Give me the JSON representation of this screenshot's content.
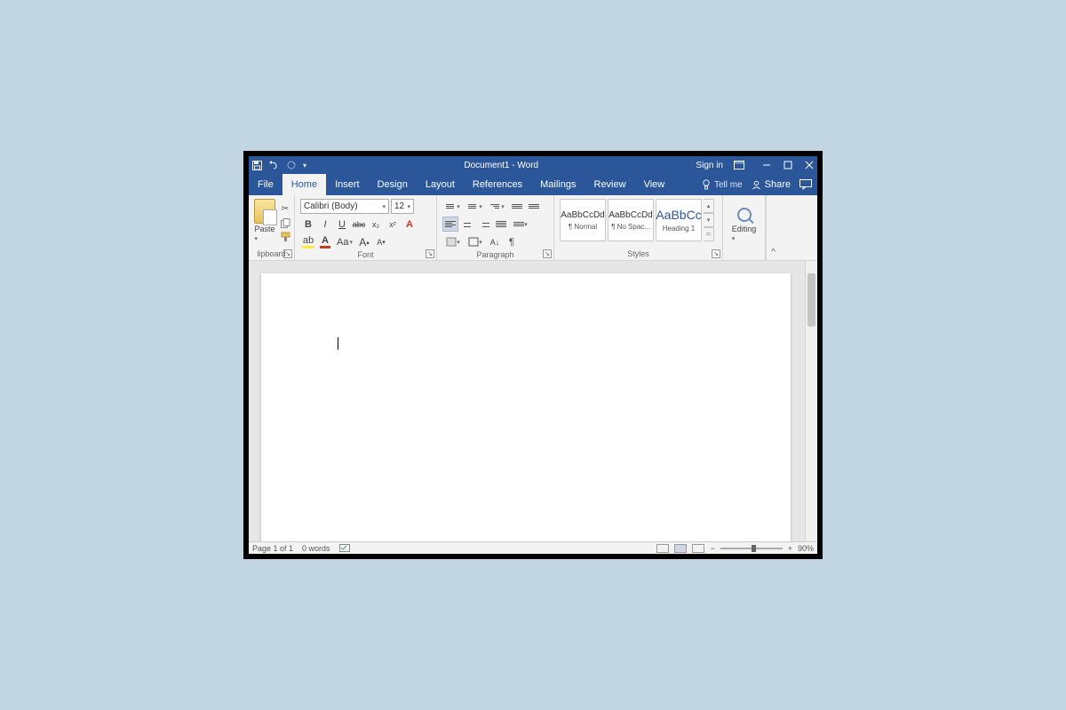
{
  "title": "Document1  -  Word",
  "sign_in": "Sign in",
  "tabs": {
    "file": "File",
    "home": "Home",
    "insert": "Insert",
    "design": "Design",
    "layout": "Layout",
    "references": "References",
    "mailings": "Mailings",
    "review": "Review",
    "view": "View"
  },
  "tellme": "Tell me",
  "share": "Share",
  "clipboard": {
    "paste": "Paste",
    "label": "lipboard"
  },
  "font": {
    "name": "Calibri (Body)",
    "size": "12",
    "label": "Font",
    "bold": "B",
    "italic": "I",
    "underline": "U",
    "strike": "abc",
    "sub": "x₂",
    "sup": "x²",
    "case": "Aa",
    "grow": "A",
    "shrink": "A"
  },
  "paragraph": {
    "label": "Paragraph"
  },
  "styles_group": {
    "label": "Styles",
    "sample": "AaBbCcDd",
    "sample_h": "AaBbCc",
    "normal": "¶ Normal",
    "nospace": "¶ No Spac...",
    "heading1": "Heading 1"
  },
  "editing": {
    "label": "Editing"
  },
  "status": {
    "page": "Page 1 of 1",
    "words": "0 words",
    "zoom": "90%"
  }
}
